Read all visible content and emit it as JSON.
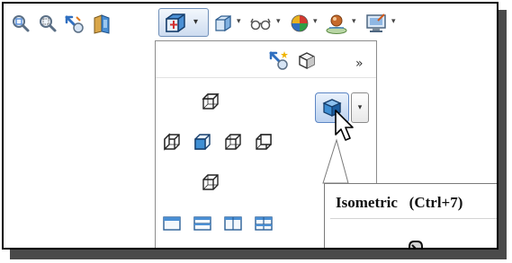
{
  "toolbar": {
    "items": [
      {
        "name": "zoom-to-fit-icon",
        "dropdown": false
      },
      {
        "name": "zoom-to-area-icon",
        "dropdown": false
      },
      {
        "name": "previous-view-icon",
        "dropdown": false
      },
      {
        "name": "section-view-icon",
        "dropdown": false
      },
      {
        "name": "view-orientation-icon",
        "dropdown": true,
        "active": true
      },
      {
        "name": "display-style-icon",
        "dropdown": true
      },
      {
        "name": "hide-show-items-icon",
        "dropdown": true
      },
      {
        "name": "edit-appearance-icon",
        "dropdown": true
      },
      {
        "name": "apply-scene-icon",
        "dropdown": true
      },
      {
        "name": "view-settings-icon",
        "dropdown": true
      }
    ],
    "dropdown_glyph": "▾"
  },
  "flyout": {
    "top_icons": [
      "new-view-icon",
      "view-selector-icon"
    ],
    "more_glyph": "»",
    "views": [
      "top-view-icon",
      "left-view-icon",
      "front-view-icon",
      "right-view-icon",
      "back-view-icon",
      "bottom-view-icon"
    ],
    "isometric_icon": "isometric-view-icon",
    "single_view_icons": [
      "single-view-icon",
      "two-view-horizontal-icon",
      "two-view-vertical-icon",
      "four-view-icon"
    ],
    "up_arrow_glyph": "↑"
  },
  "tooltip": {
    "label": "Isometric",
    "shortcut": "(Ctrl+7)"
  },
  "colors": {
    "accent": "#5d86c4",
    "cube_face": "#3f8fd4",
    "cube_dark": "#1c5da0"
  }
}
